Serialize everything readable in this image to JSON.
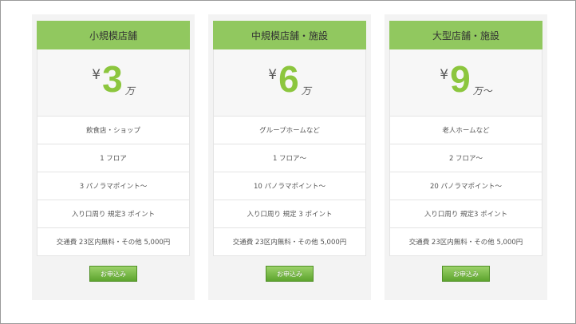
{
  "plans": [
    {
      "title": "小規模店舗",
      "currency": "¥",
      "price": "3",
      "unit": "万",
      "features": [
        "飲食店・ショップ",
        "1 フロア",
        "3 パノラマポイント～",
        "入り口周り 規定3 ポイント",
        "交通費 23区内無料・その他 5,000円"
      ],
      "button": "お申込み"
    },
    {
      "title": "中規模店舗・施設",
      "currency": "¥",
      "price": "6",
      "unit": "万",
      "features": [
        "グループホームなど",
        "1 フロア～",
        "10 パノラマポイント～",
        "入り口周り 規定 3 ポイント",
        "交通費 23区内無料・その他 5,000円"
      ],
      "button": "お申込み"
    },
    {
      "title": "大型店舗・施設",
      "currency": "¥",
      "price": "9",
      "unit": "万～",
      "features": [
        "老人ホームなど",
        "2 フロア～",
        "20 パノラマポイント～",
        "入り口周り 規定3 ポイント",
        "交通費 23区内無料・その他 5,000円"
      ],
      "button": "お申込み"
    }
  ],
  "colors": {
    "accent": "#8cc63e",
    "header": "#91c85f",
    "button": "#6fb03a"
  }
}
